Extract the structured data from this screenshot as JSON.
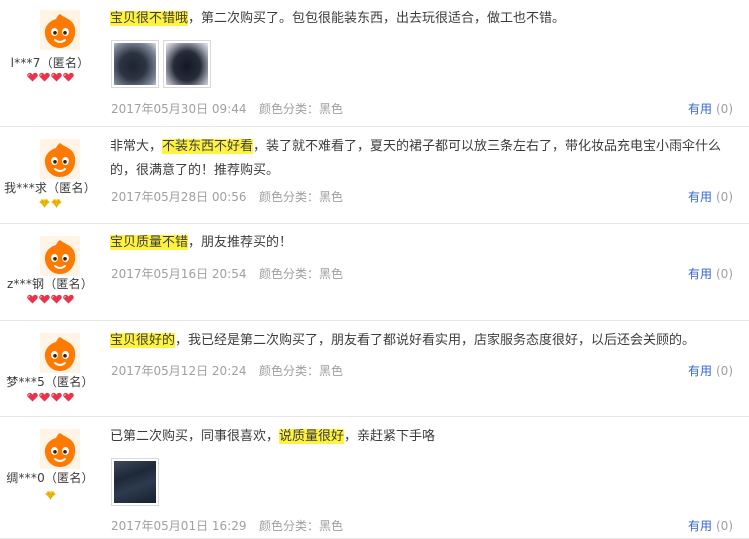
{
  "colors": {
    "highlight": "#fff33d",
    "link": "#3366cc",
    "meta": "#a0a0a0",
    "badge_red": "#e8334a",
    "badge_gold": "#f6c20d"
  },
  "useful_label": "有用",
  "color_label": "颜色分类：",
  "reviews": [
    {
      "user": "l***7（匿名）",
      "badge_type": "red",
      "badge_count": 4,
      "avatar_icon": "taobao-avatar-icon",
      "text_hl": "宝贝很不错哦",
      "text_rest": "，第二次购买了。包包很能装东西，出去玩很适合，做工也不错。",
      "text_pre": "",
      "photos": [
        "photo-black-bag",
        "photo-black-bag-2"
      ],
      "date": "2017年05月30日 09:44",
      "color_value": "黑色",
      "useful_count": "(0)"
    },
    {
      "user": "我***求（匿名）",
      "badge_type": "gold",
      "badge_count": 2,
      "avatar_icon": "taobao-avatar-icon",
      "text_pre": "非常大，",
      "text_hl": "不装东西不好看",
      "text_rest": "，装了就不难看了，夏天的裙子都可以放三条左右了，带化妆品充电宝小雨伞什么的，很满意了的！推荐购买。",
      "photos": [],
      "date": "2017年05月28日 00:56",
      "color_value": "黑色",
      "useful_count": "(0)"
    },
    {
      "user": "z***钢（匿名）",
      "badge_type": "red",
      "badge_count": 4,
      "avatar_icon": "taobao-avatar-icon",
      "text_pre": "",
      "text_hl": "宝贝质量不错",
      "text_rest": "，朋友推荐买的！",
      "photos": [],
      "date": "2017年05月16日 20:54",
      "color_value": "黑色",
      "useful_count": "(0)"
    },
    {
      "user": "梦***5（匿名）",
      "badge_type": "red",
      "badge_count": 4,
      "avatar_icon": "taobao-avatar-icon",
      "text_pre": "",
      "text_hl": "宝贝很好的",
      "text_rest": "，我已经是第二次购买了，朋友看了都说好看实用，店家服务态度很好，以后还会关顾的。",
      "photos": [],
      "date": "2017年05月12日 20:24",
      "color_value": "黑色",
      "useful_count": "(0)"
    },
    {
      "user": "绸***0（匿名）",
      "badge_type": "gold",
      "badge_count": 1,
      "avatar_icon": "taobao-avatar-icon",
      "text_pre": "已第二次购买，同事很喜欢，",
      "text_hl": "说质量很好",
      "text_rest": "，亲赶紧下手咯",
      "photos": [
        "photo-dark-bag"
      ],
      "date": "2017年05月01日 16:29",
      "color_value": "黑色",
      "useful_count": "(0)"
    }
  ]
}
